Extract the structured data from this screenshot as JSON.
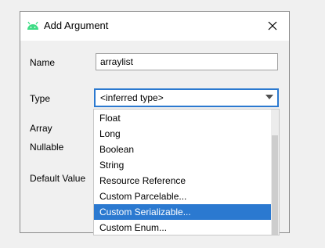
{
  "dialog": {
    "title": "Add Argument",
    "icon": "android-icon",
    "close_icon": "close-icon",
    "close_glyph": "✕"
  },
  "form": {
    "name_label": "Name",
    "name_value": "arraylist",
    "type_label": "Type",
    "type_value": "<inferred type>",
    "array_label": "Array",
    "nullable_label": "Nullable",
    "default_label": "Default Value"
  },
  "dropdown": {
    "items": [
      "Float",
      "Long",
      "Boolean",
      "String",
      "Resource Reference",
      "Custom Parcelable...",
      "Custom Serializable...",
      "Custom Enum..."
    ],
    "selected": "Custom Serializable..."
  },
  "colors": {
    "accent": "#2b79d0",
    "android_green": "#3ddc84"
  }
}
